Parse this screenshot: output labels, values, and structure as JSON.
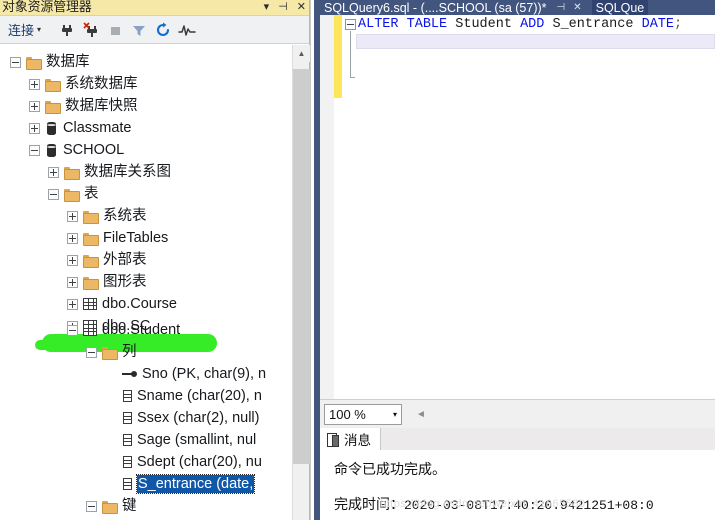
{
  "explorer": {
    "title": "对象资源管理器",
    "titlebar_buttons": [
      {
        "name": "dropdown",
        "glyph": "▾"
      },
      {
        "name": "pin",
        "glyph": "⊣"
      },
      {
        "name": "close",
        "glyph": "✕"
      }
    ],
    "toolbar": {
      "connect_label": "连接",
      "connect_caret": "▾",
      "buttons": [
        {
          "name": "connect-icon",
          "title": "连接"
        },
        {
          "name": "disconnect-icon",
          "title": "断开连接"
        },
        {
          "name": "stop-icon",
          "title": "停止"
        },
        {
          "name": "filter-icon",
          "title": "筛选器"
        },
        {
          "name": "refresh-icon",
          "title": "刷新"
        },
        {
          "name": "activity-monitor-icon",
          "title": "活动监视器"
        }
      ]
    },
    "tree": [
      {
        "label": "数据库",
        "indent": 0,
        "icon": "folder",
        "state": "minus"
      },
      {
        "label": "系统数据库",
        "indent": 1,
        "icon": "folder",
        "state": "plus"
      },
      {
        "label": "数据库快照",
        "indent": 1,
        "icon": "folder",
        "state": "plus"
      },
      {
        "label": "Classmate",
        "indent": 1,
        "icon": "database",
        "state": "plus"
      },
      {
        "label": "SCHOOL",
        "indent": 1,
        "icon": "database",
        "state": "minus"
      },
      {
        "label": "数据库关系图",
        "indent": 2,
        "icon": "folder",
        "state": "plus"
      },
      {
        "label": "表",
        "indent": 2,
        "icon": "folder",
        "state": "minus"
      },
      {
        "label": "系统表",
        "indent": 3,
        "icon": "folder",
        "state": "plus"
      },
      {
        "label": "FileTables",
        "indent": 3,
        "icon": "folder",
        "state": "plus"
      },
      {
        "label": "外部表",
        "indent": 3,
        "icon": "folder",
        "state": "plus"
      },
      {
        "label": "图形表",
        "indent": 3,
        "icon": "folder",
        "state": "plus"
      },
      {
        "label": "dbo.Course",
        "indent": 3,
        "icon": "table",
        "state": "plus"
      },
      {
        "label": "dbo.SC",
        "indent": 3,
        "icon": "table",
        "state": "plus"
      },
      {
        "label": "dbo.Student",
        "indent": 3,
        "icon": "table",
        "state": "minus",
        "highlighted": true
      },
      {
        "label": "列",
        "indent": 4,
        "icon": "folder",
        "state": "minus"
      },
      {
        "label": "Sno (PK, char(9), n",
        "indent": 5,
        "icon": "key",
        "state": "none"
      },
      {
        "label": "Sname (char(20), n",
        "indent": 5,
        "icon": "column",
        "state": "none"
      },
      {
        "label": "Ssex (char(2), null)",
        "indent": 5,
        "icon": "column",
        "state": "none"
      },
      {
        "label": "Sage (smallint, nul",
        "indent": 5,
        "icon": "column",
        "state": "none"
      },
      {
        "label": "Sdept (char(20), nu",
        "indent": 5,
        "icon": "column",
        "state": "none"
      },
      {
        "label": "S_entrance (date, ",
        "indent": 5,
        "icon": "column",
        "state": "none",
        "selected": true
      },
      {
        "label": "键",
        "indent": 4,
        "icon": "folder",
        "state": "minus"
      }
    ],
    "highlight_color": "#35ec26"
  },
  "query": {
    "tabs": [
      {
        "label": "SQLQuery6.sql - (....SCHOOL (sa (57))*",
        "active": true
      },
      {
        "label": "SQLQue",
        "active": false
      }
    ],
    "tab_controls": [
      {
        "name": "pin",
        "glyph": "⊣"
      },
      {
        "name": "close",
        "glyph": "✕"
      }
    ],
    "code": {
      "tokens": [
        {
          "text": "ALTER",
          "type": "keyword"
        },
        {
          "text": " ",
          "type": "plain"
        },
        {
          "text": "TABLE",
          "type": "keyword"
        },
        {
          "text": " Student ",
          "type": "plain"
        },
        {
          "text": "ADD",
          "type": "keyword"
        },
        {
          "text": " S_entrance ",
          "type": "plain"
        },
        {
          "text": "DATE",
          "type": "keyword"
        },
        {
          "text": ";",
          "type": "punct"
        }
      ],
      "full_text": "ALTER TABLE Student ADD S_entrance DATE;"
    },
    "zoom": {
      "value": "100 %",
      "caret": "▾"
    },
    "hscroll_left_glyph": "◄",
    "results": {
      "tab_label": "消息",
      "line1": "命令已成功完成。",
      "line2_label": "完成时间：",
      "line2_value": "2020-03-08T17:40:20.9421251+08:0",
      "watermark": "https://blog.csdn.net/weixin_41665580"
    }
  }
}
